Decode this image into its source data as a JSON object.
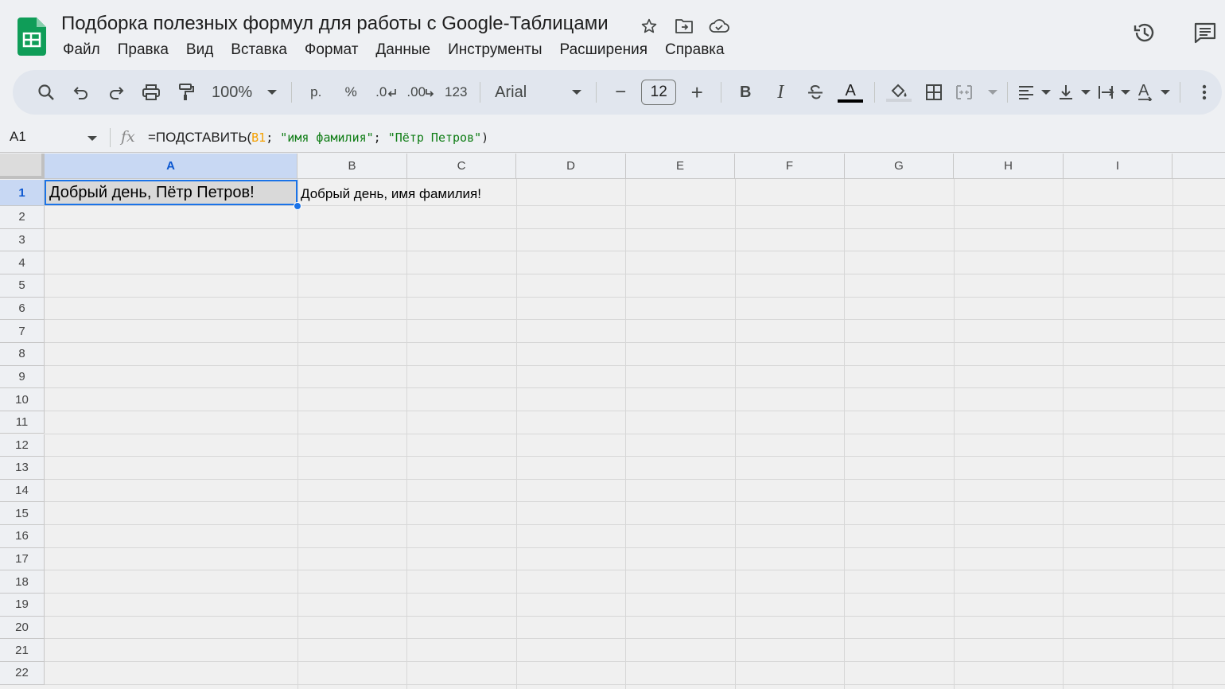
{
  "app": {
    "title": "Подборка полезных формул для работы с Google-Таблицами",
    "icons": [
      "sheets-logo-icon",
      "star-icon",
      "move-folder-icon",
      "cloud-status-icon",
      "version-history-icon",
      "comments-icon"
    ],
    "brand_color": "#0f9d58"
  },
  "menu": [
    "Файл",
    "Правка",
    "Вид",
    "Вставка",
    "Формат",
    "Данные",
    "Инструменты",
    "Расширения",
    "Справка"
  ],
  "toolbar": {
    "zoom": "100%",
    "currency": "р.",
    "percent": "%",
    "dec_decrease": ".0",
    "dec_increase": ".00",
    "number_format": "123",
    "font": "Arial",
    "font_size": "12",
    "bold": "B",
    "italic": "I",
    "text_color_letter": "A",
    "rotate_letter": "A",
    "minus": "−",
    "plus": "+"
  },
  "formula_bar": {
    "cell_ref": "A1",
    "fx": "fx",
    "f_prefix": "=ПОДСТАВИТЬ(",
    "f_ref": "B1",
    "f_sep1": "; ",
    "f_str1": "\"имя фамилия\"",
    "f_sep2": "; ",
    "f_str2": "\"Пётр Петров\"",
    "f_suffix": ")"
  },
  "grid": {
    "columns": [
      "A",
      "B",
      "C",
      "D",
      "E",
      "F",
      "G",
      "H",
      "I"
    ],
    "rows": [
      "1",
      "2",
      "3",
      "4",
      "5",
      "6",
      "7",
      "8",
      "9",
      "10",
      "11",
      "12",
      "13",
      "14",
      "15",
      "16",
      "17",
      "18",
      "19",
      "20",
      "21",
      "22"
    ],
    "active_cell": "A1",
    "cells": {
      "A1": "Добрый день, Пётр Петров!",
      "B1": "Добрый день, имя фамилия!"
    },
    "selection_color": "#1a73e8"
  }
}
